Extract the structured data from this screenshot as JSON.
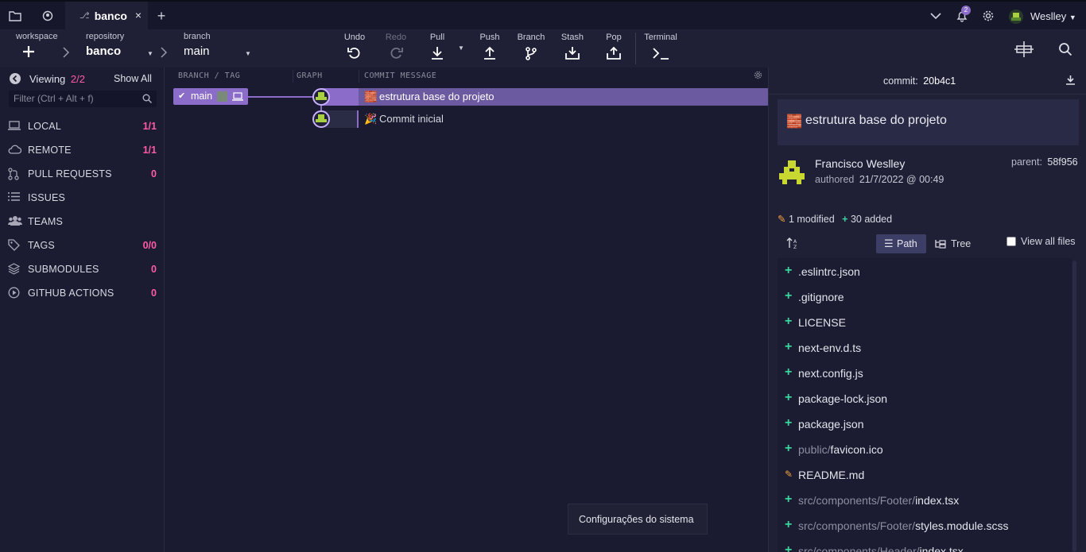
{
  "tabbar": {
    "tab_label": "banco",
    "close": "×",
    "new_tab": "+",
    "notifications_count": "2",
    "user_name": "Weslley"
  },
  "toolbar": {
    "workspace_label": "workspace",
    "repository_label": "repository",
    "repository_value": "banco",
    "branch_label": "branch",
    "branch_value": "main",
    "undo": "Undo",
    "redo": "Redo",
    "pull": "Pull",
    "push": "Push",
    "branch": "Branch",
    "stash": "Stash",
    "pop": "Pop",
    "terminal": "Terminal"
  },
  "left_panel": {
    "viewing_label": "Viewing",
    "viewing_count": "2/2",
    "show_all": "Show All",
    "filter_placeholder": "Filter (Ctrl + Alt + f)",
    "sections": [
      {
        "name": "LOCAL",
        "count": "1/1",
        "icon": "laptop-icon"
      },
      {
        "name": "REMOTE",
        "count": "1/1",
        "icon": "cloud-icon"
      },
      {
        "name": "PULL REQUESTS",
        "count": "0",
        "icon": "pull-request-icon"
      },
      {
        "name": "ISSUES",
        "count": "",
        "icon": "list-icon"
      },
      {
        "name": "TEAMS",
        "count": "",
        "icon": "users-icon"
      },
      {
        "name": "TAGS",
        "count": "0/0",
        "icon": "tag-icon"
      },
      {
        "name": "SUBMODULES",
        "count": "0",
        "icon": "layers-icon"
      },
      {
        "name": "GITHUB ACTIONS",
        "count": "0",
        "icon": "play-circle-icon"
      }
    ]
  },
  "graph": {
    "col_branch": "BRANCH / TAG",
    "col_graph": "GRAPH",
    "col_message": "COMMIT MESSAGE",
    "branch_label": "main",
    "commits": [
      {
        "emoji": "🧱",
        "message": "estrutura base do projeto",
        "selected": true
      },
      {
        "emoji": "🎉",
        "message": "Commit inicial",
        "selected": false
      }
    ]
  },
  "commit_panel": {
    "commit_label": "commit:",
    "commit_sha": "20b4c1",
    "title_emoji": "🧱",
    "title": "estrutura base do projeto",
    "author": "Francisco Weslley",
    "authored_label": "authored",
    "authored_date": "21/7/2022 @ 00:49",
    "parent_label": "parent:",
    "parent_sha": "58f956",
    "modified_summary": "1 modified",
    "added_summary": "30 added",
    "view_path": "Path",
    "view_tree": "Tree",
    "view_all_files": "View all files",
    "files": [
      {
        "status": "added",
        "dir": "",
        "name": ".eslintrc.json"
      },
      {
        "status": "added",
        "dir": "",
        "name": ".gitignore"
      },
      {
        "status": "added",
        "dir": "",
        "name": "LICENSE"
      },
      {
        "status": "added",
        "dir": "",
        "name": "next-env.d.ts"
      },
      {
        "status": "added",
        "dir": "",
        "name": "next.config.js"
      },
      {
        "status": "added",
        "dir": "",
        "name": "package-lock.json"
      },
      {
        "status": "added",
        "dir": "",
        "name": "package.json"
      },
      {
        "status": "added",
        "dir": "public/",
        "name": "favicon.ico"
      },
      {
        "status": "modified",
        "dir": "",
        "name": "README.md"
      },
      {
        "status": "added",
        "dir": "src/components/Footer/",
        "name": "index.tsx"
      },
      {
        "status": "added",
        "dir": "src/components/Footer/",
        "name": "styles.module.scss"
      },
      {
        "status": "added",
        "dir": "src/components/Header/",
        "name": "index.tsx"
      }
    ]
  },
  "tooltip": "Configurações do sistema",
  "colors": {
    "accent_purple": "#8b6cc8",
    "count_pink": "#ff5aa8",
    "added_green": "#3ad4a0",
    "modified_orange": "#f0a040"
  }
}
